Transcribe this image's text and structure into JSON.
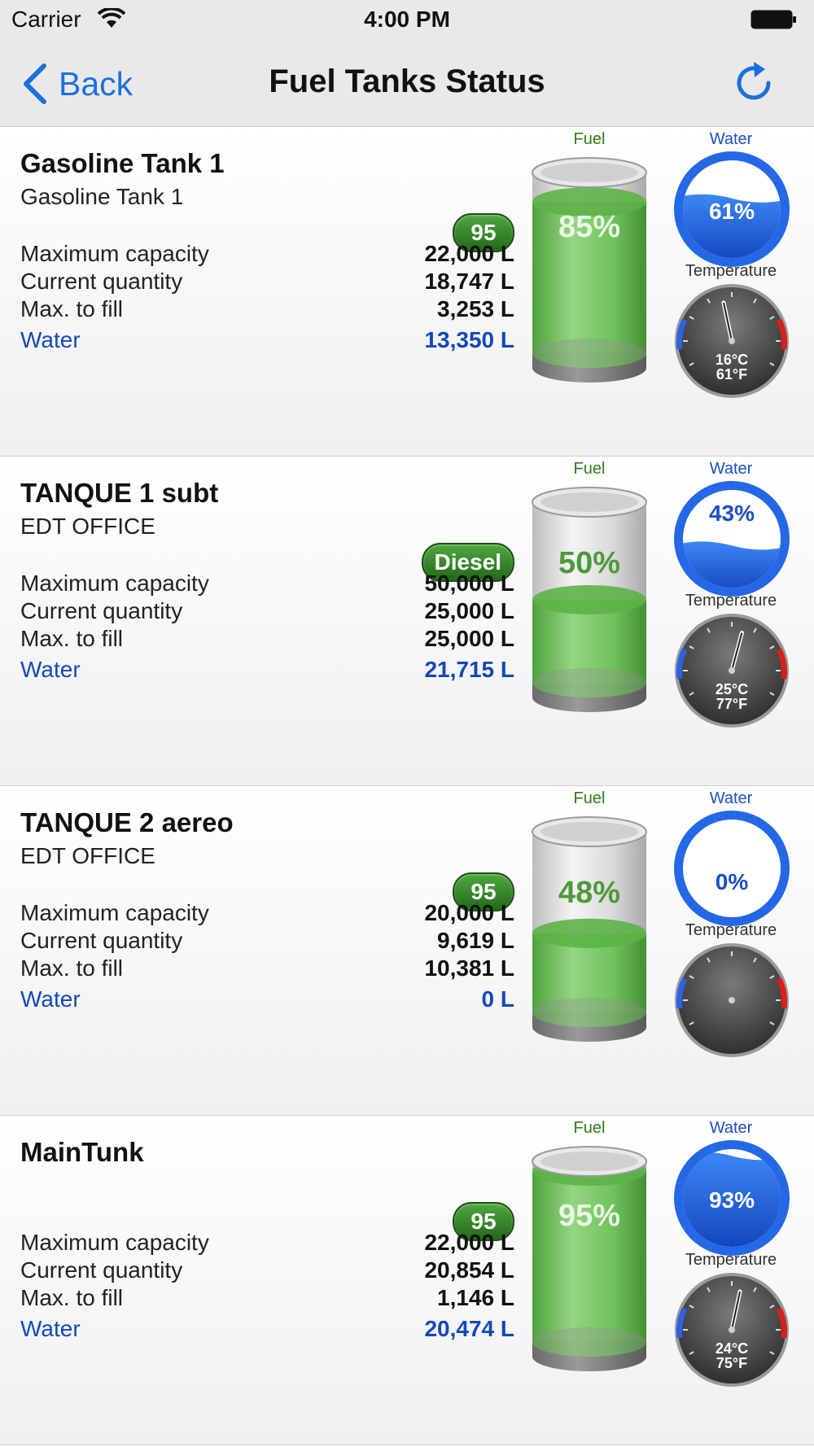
{
  "status_bar": {
    "carrier": "Carrier",
    "time": "4:00 PM"
  },
  "nav": {
    "back_label": "Back",
    "title": "Fuel Tanks Status"
  },
  "labels": {
    "max_capacity": "Maximum capacity",
    "current_quantity": "Current quantity",
    "max_to_fill": "Max. to fill",
    "water": "Water",
    "gauge_fuel": "Fuel",
    "gauge_water": "Water",
    "gauge_temperature": "Temperature"
  },
  "colors": {
    "accent_blue": "#1d6fdc",
    "water_text_blue": "#1448b8",
    "fuel_green": "#4fb33c",
    "water_gauge_blue": "#1e5fdc"
  },
  "tanks": [
    {
      "name": "Gasoline Tank 1",
      "subtitle": "Gasoline Tank 1",
      "fuel_type": "95",
      "max_capacity": "22,000 L",
      "current_quantity": "18,747 L",
      "max_to_fill": "3,253 L",
      "water": "13,350 L",
      "fuel_percent_label": "85%",
      "fuel_percent": 85,
      "water_percent_label": "61%",
      "water_percent": 61,
      "temp_c": "16°C",
      "temp_f": "61°F",
      "temp_value_c": 16
    },
    {
      "name": "TANQUE 1 subt",
      "subtitle": "EDT OFFICE",
      "fuel_type": "Diesel",
      "max_capacity": "50,000 L",
      "current_quantity": "25,000 L",
      "max_to_fill": "25,000 L",
      "water": "21,715 L",
      "fuel_percent_label": "50%",
      "fuel_percent": 50,
      "water_percent_label": "43%",
      "water_percent": 43,
      "temp_c": "25°C",
      "temp_f": "77°F",
      "temp_value_c": 25
    },
    {
      "name": "TANQUE 2 aereo",
      "subtitle": "EDT OFFICE",
      "fuel_type": "95",
      "max_capacity": "20,000 L",
      "current_quantity": "9,619 L",
      "max_to_fill": "10,381 L",
      "water": "0 L",
      "fuel_percent_label": "48%",
      "fuel_percent": 48,
      "water_percent_label": "0%",
      "water_percent": 0,
      "temp_c": "",
      "temp_f": "",
      "temp_value_c": null
    },
    {
      "name": "MainTunk",
      "subtitle": "",
      "fuel_type": "95",
      "max_capacity": "22,000 L",
      "current_quantity": "20,854 L",
      "max_to_fill": "1,146 L",
      "water": "20,474 L",
      "fuel_percent_label": "95%",
      "fuel_percent": 95,
      "water_percent_label": "93%",
      "water_percent": 93,
      "temp_c": "24°C",
      "temp_f": "75°F",
      "temp_value_c": 24
    }
  ]
}
